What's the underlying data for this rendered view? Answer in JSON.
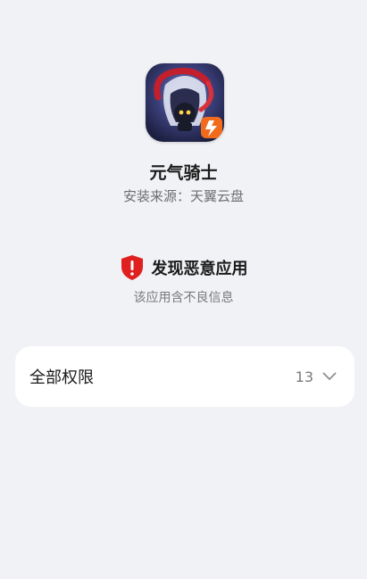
{
  "app": {
    "name": "元气骑士",
    "install_source": "安装来源：天翼云盘",
    "icon": "soul-knight-app-icon"
  },
  "warning": {
    "title": "发现恶意应用",
    "subtitle": "该应用含不良信息",
    "icon": "shield-alert-icon",
    "color": "#e02020"
  },
  "permissions": {
    "label": "全部权限",
    "count": "13",
    "expand_icon": "chevron-down-icon"
  },
  "colors": {
    "background": "#f1f2f5",
    "card": "#ffffff"
  }
}
